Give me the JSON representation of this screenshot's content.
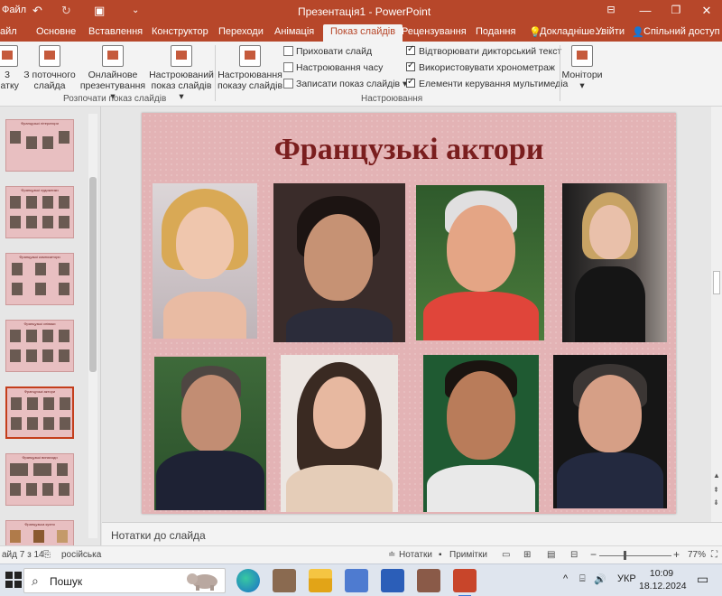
{
  "titlebar": {
    "title": "Презентація1 - PowerPoint",
    "left_label": "Файл",
    "icons": [
      "save-icon",
      "undo-icon",
      "redo-icon",
      "start-from-beginning-icon",
      "customize-icon"
    ],
    "right_icons": [
      "ribbon-display-icon",
      "minimize-icon",
      "restore-icon",
      "close-icon"
    ]
  },
  "tabs": [
    {
      "label": "айл"
    },
    {
      "label": "Основне"
    },
    {
      "label": "Вставлення"
    },
    {
      "label": "Конструктор"
    },
    {
      "label": "Переходи"
    },
    {
      "label": "Анімація"
    },
    {
      "label": "Показ слайдів",
      "active": true
    },
    {
      "label": "Рецензування"
    },
    {
      "label": "Подання"
    },
    {
      "label": "Докладніше..."
    },
    {
      "label": "Увійти"
    },
    {
      "label": "Спільний доступ"
    }
  ],
  "ribbon": {
    "start_group": {
      "label": "Розпочати показ слайдів",
      "buttons": [
        {
          "label1": "3",
          "label2": "чатку"
        },
        {
          "label1": "З поточного",
          "label2": "слайда"
        },
        {
          "label1": "Онлайнове",
          "label2": "презентування ▾"
        },
        {
          "label1": "Настроюваний",
          "label2": "показ слайдів ▾"
        }
      ]
    },
    "setup_group": {
      "label": "Настроювання",
      "big_button": {
        "label1": "Настроювання",
        "label2": "показу слайдів"
      },
      "small": [
        "Приховати слайд",
        "Настроювання часу",
        "Записати показ слайдів ▾"
      ],
      "checks": [
        "Відтворювати дикторський текст",
        "Використовувати хронометраж",
        "Елементи керування мультимедіа"
      ]
    },
    "monitors": {
      "label": "Монітори",
      "arrow": "▾"
    }
  },
  "thumbnails": [
    {
      "title": "Французькі літератори"
    },
    {
      "title": "Французькі художники"
    },
    {
      "title": "Французькі композитори"
    },
    {
      "title": "Французькі співаки"
    },
    {
      "title": "Французькі актори",
      "selected": true
    },
    {
      "title": "Французькі винаходи"
    },
    {
      "title": "Французька кухня"
    }
  ],
  "slide": {
    "title": "Французькі актори"
  },
  "notes": {
    "placeholder": "Нотатки до слайда"
  },
  "status": {
    "slide_info": "айд 7 з 14",
    "language": "російська",
    "notes_btn": "Нотатки",
    "comments_btn": "Примітки",
    "zoom": "77%",
    "zoom_minus": "−",
    "zoom_plus": "+"
  },
  "taskbar": {
    "search_placeholder": "Пошук",
    "lang": "УКР",
    "time": "10:09",
    "date": "18.12.2024"
  }
}
